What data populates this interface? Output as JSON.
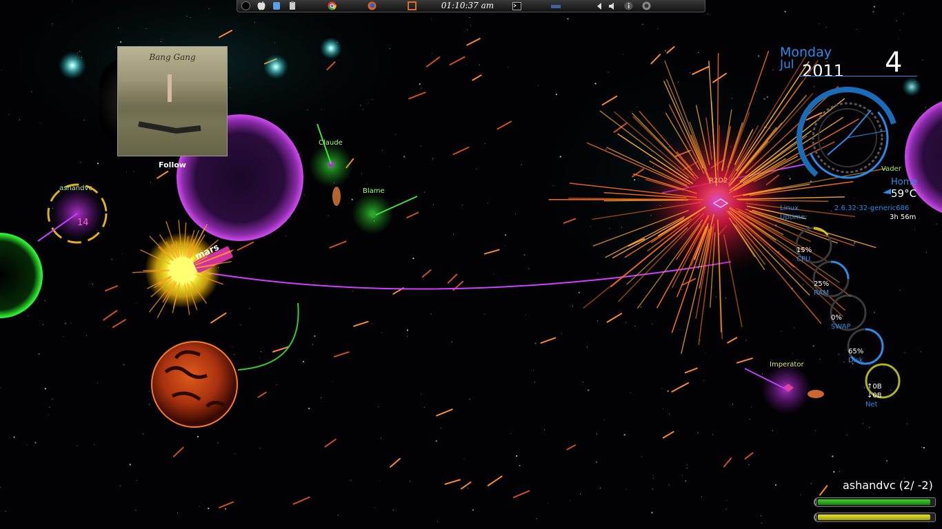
{
  "top_panel": {
    "clock": "01:10:37 am",
    "icons": [
      "circle-icon",
      "apple-icon",
      "finder-icon",
      "clipboard-icon",
      "chrome-icon",
      "firefox-icon",
      "virtualbox-icon",
      "terminal-icon",
      "network-icon",
      "volume-icon",
      "info-icon",
      "settings-icon"
    ]
  },
  "album": {
    "title": "Bang Gang",
    "follow_label": "Follow"
  },
  "players": {
    "ashandvc": "ashandvc",
    "ashandvc_score": "14",
    "claude": "Claude",
    "blame": "Blame",
    "r2d2": "R2D2",
    "vader": "Vader",
    "imperator": "Imperator"
  },
  "planet_label": "mars",
  "widgets": {
    "date": {
      "day": "Monday",
      "month": "Jul",
      "year": "2011",
      "date": "4"
    },
    "temp": {
      "label": "Home",
      "value": "59°C"
    },
    "system": {
      "os": "Linux",
      "kernel": "2.6.32-32-generic686",
      "uptime_label": "Uptime:",
      "uptime": "3h 56m"
    },
    "stats": [
      {
        "value": "15%",
        "label": "CPU",
        "level": 0.15
      },
      {
        "value": "25%",
        "label": "RAM",
        "level": 0.25
      },
      {
        "value": "0%",
        "label": "SWAP",
        "level": 0.0
      },
      {
        "value": "65%",
        "label": "Disk",
        "level": 0.65
      }
    ],
    "net": {
      "up": "↑0B",
      "down": "↓0B",
      "label": "Net"
    }
  },
  "hud": {
    "player": "ashandvc (2/ -2)",
    "health_level": 0.97,
    "energy_level": 0.97
  },
  "colors": {
    "accent_blue": "#2a8ce8",
    "health_green": "#3ed12a",
    "energy_yellow": "#e6e220",
    "purple": "#c93ce0",
    "magenta": "#ff3fe0"
  }
}
